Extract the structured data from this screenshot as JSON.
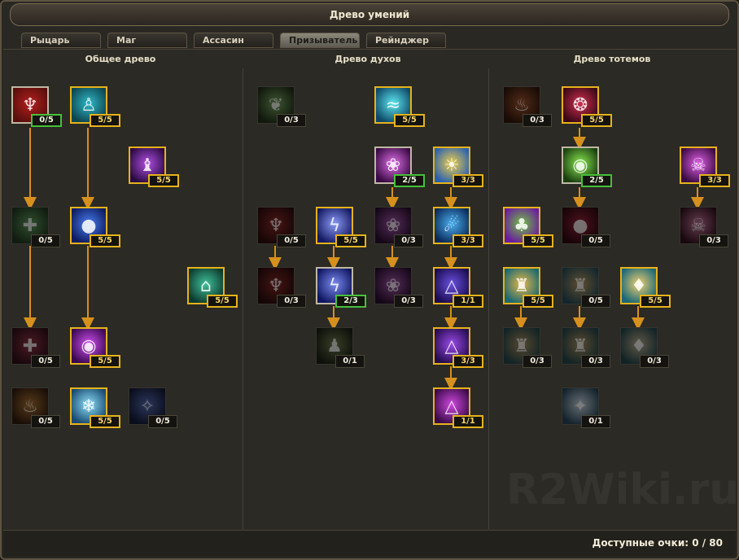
{
  "window": {
    "title": "Древо умений"
  },
  "tabs": [
    {
      "label": "Рыцарь",
      "active": false
    },
    {
      "label": "Маг",
      "active": false
    },
    {
      "label": "Ассасин",
      "active": false
    },
    {
      "label": "Призыватель",
      "active": true
    },
    {
      "label": "Рейнджер",
      "active": false
    }
  ],
  "trees": [
    {
      "title": "Общее древо"
    },
    {
      "title": "Древо духов"
    },
    {
      "title": "Древо тотемов"
    }
  ],
  "skills": [
    {
      "id": "g1",
      "count": "0/5",
      "state": "partial",
      "icon": "demon-icon",
      "colors": [
        "#b4201e",
        "#5a0e0c"
      ]
    },
    {
      "id": "g2",
      "count": "5/5",
      "state": "maxed",
      "icon": "spirit-figure-icon",
      "colors": [
        "#2fb8c8",
        "#0d4650"
      ]
    },
    {
      "id": "g3",
      "count": "5/5",
      "state": "maxed",
      "icon": "purple-mage-icon",
      "colors": [
        "#b04ee0",
        "#2a0a44"
      ]
    },
    {
      "id": "g4",
      "count": "0/5",
      "state": "locked",
      "icon": "holy-cross-icon",
      "colors": [
        "#4ea24a",
        "#1a3a18"
      ]
    },
    {
      "id": "g5",
      "count": "5/5",
      "state": "maxed",
      "icon": "blue-orbs-icon",
      "colors": [
        "#4a7cf0",
        "#0c1c60"
      ]
    },
    {
      "id": "g6",
      "count": "5/5",
      "state": "maxed",
      "icon": "teal-shrine-icon",
      "colors": [
        "#40c098",
        "#0c3a2e"
      ]
    },
    {
      "id": "g7",
      "count": "0/5",
      "state": "locked",
      "icon": "red-cross-icon",
      "colors": [
        "#b02a48",
        "#3a0c18"
      ]
    },
    {
      "id": "g8",
      "count": "5/5",
      "state": "maxed",
      "icon": "purple-orb-icon",
      "colors": [
        "#d050f0",
        "#3a0850"
      ]
    },
    {
      "id": "g9",
      "count": "0/5",
      "state": "locked",
      "icon": "fire-sigil-icon",
      "colors": [
        "#c07018",
        "#3a1a04"
      ]
    },
    {
      "id": "g10",
      "count": "5/5",
      "state": "maxed",
      "icon": "ice-tree-icon",
      "colors": [
        "#8ae0f8",
        "#1a4a70"
      ]
    },
    {
      "id": "g11",
      "count": "0/5",
      "state": "locked",
      "icon": "blue-spirit-icon",
      "colors": [
        "#4a6ad0",
        "#101a44"
      ]
    },
    {
      "id": "s1",
      "count": "0/3",
      "state": "locked",
      "icon": "green-wisp-icon",
      "colors": [
        "#6ab048",
        "#1c3010"
      ]
    },
    {
      "id": "s2",
      "count": "5/5",
      "state": "maxed",
      "icon": "cyan-wave-icon",
      "colors": [
        "#5ee8f0",
        "#0e4868"
      ]
    },
    {
      "id": "s3",
      "count": "2/5",
      "state": "partial",
      "icon": "pink-lotus-icon",
      "colors": [
        "#e070e8",
        "#3a0a44"
      ]
    },
    {
      "id": "s4",
      "count": "3/3",
      "state": "maxed",
      "icon": "sun-cloud-icon",
      "colors": [
        "#f0d048",
        "#2a60b0"
      ]
    },
    {
      "id": "s5",
      "count": "0/5",
      "state": "locked",
      "icon": "red-demon-icon",
      "colors": [
        "#b02020",
        "#3a0808"
      ]
    },
    {
      "id": "s6",
      "count": "5/5",
      "state": "maxed",
      "icon": "lightning-tree-icon",
      "colors": [
        "#8a9af8",
        "#141a60"
      ]
    },
    {
      "id": "s7",
      "count": "0/3",
      "state": "locked",
      "icon": "pink-lotus-icon",
      "colors": [
        "#c050c8",
        "#300a38"
      ]
    },
    {
      "id": "s8",
      "count": "3/3",
      "state": "maxed",
      "icon": "blue-wraith-icon",
      "colors": [
        "#4ab0f0",
        "#0a2a5a"
      ]
    },
    {
      "id": "s9",
      "count": "0/3",
      "state": "locked",
      "icon": "red-demon-icon",
      "colors": [
        "#a82020",
        "#340808"
      ]
    },
    {
      "id": "s10",
      "count": "2/3",
      "state": "partial",
      "icon": "lightning-tree-icon",
      "colors": [
        "#7a8af0",
        "#101660"
      ]
    },
    {
      "id": "s11",
      "count": "0/3",
      "state": "locked",
      "icon": "pink-lotus-icon",
      "colors": [
        "#c050c8",
        "#300a38"
      ]
    },
    {
      "id": "s12",
      "count": "1/1",
      "state": "maxed",
      "icon": "triangle-rune-icon",
      "colors": [
        "#6a50e0",
        "#1a0c50"
      ]
    },
    {
      "id": "s13",
      "count": "0/1",
      "state": "locked",
      "icon": "hooded-figure-icon",
      "colors": [
        "#6a8040",
        "#1a2010"
      ]
    },
    {
      "id": "s14",
      "count": "3/3",
      "state": "maxed",
      "icon": "triangle-rune-icon",
      "colors": [
        "#9a4ae8",
        "#260c50"
      ]
    },
    {
      "id": "s15",
      "count": "1/1",
      "state": "maxed",
      "icon": "triangle-rune-icon",
      "colors": [
        "#d048e0",
        "#3a0a48"
      ]
    },
    {
      "id": "t1",
      "count": "0/3",
      "state": "locked",
      "icon": "fire-totem-icon",
      "colors": [
        "#c05018",
        "#3a1404"
      ]
    },
    {
      "id": "t2",
      "count": "5/5",
      "state": "maxed",
      "icon": "crimson-spirit-icon",
      "colors": [
        "#d03050",
        "#3a0816"
      ]
    },
    {
      "id": "t3",
      "count": "2/5",
      "state": "partial",
      "icon": "green-orb-icon",
      "colors": [
        "#8ae850",
        "#1a4010"
      ]
    },
    {
      "id": "t4",
      "count": "3/3",
      "state": "maxed",
      "icon": "skull-sigil-icon",
      "colors": [
        "#e060e8",
        "#3a0a40"
      ]
    },
    {
      "id": "t5",
      "count": "5/5",
      "state": "maxed",
      "icon": "nature-totem-icon",
      "colors": [
        "#70c040",
        "#6a1aa0"
      ]
    },
    {
      "id": "t6",
      "count": "0/5",
      "state": "locked",
      "icon": "blood-drop-icon",
      "colors": [
        "#c01838",
        "#3a0410"
      ]
    },
    {
      "id": "t7",
      "count": "0/3",
      "state": "locked",
      "icon": "pink-skull-icon",
      "colors": [
        "#e070a0",
        "#3a0c20"
      ]
    },
    {
      "id": "t8",
      "count": "5/5",
      "state": "maxed",
      "icon": "bronze-totem-icon",
      "colors": [
        "#e8b848",
        "#1a6870"
      ]
    },
    {
      "id": "t9",
      "count": "0/5",
      "state": "locked",
      "icon": "bronze-totem-icon",
      "colors": [
        "#c89848",
        "#1a5060"
      ]
    },
    {
      "id": "t10",
      "count": "5/5",
      "state": "maxed",
      "icon": "golden-flame-icon",
      "colors": [
        "#f0d070",
        "#1a6878"
      ]
    },
    {
      "id": "t11",
      "count": "0/3",
      "state": "locked",
      "icon": "bronze-totem-icon",
      "colors": [
        "#b89048",
        "#184850"
      ]
    },
    {
      "id": "t12",
      "count": "0/3",
      "state": "locked",
      "icon": "bronze-totem-icon",
      "colors": [
        "#b89048",
        "#184850"
      ]
    },
    {
      "id": "t13",
      "count": "0/3",
      "state": "locked",
      "icon": "golden-flame-icon",
      "colors": [
        "#c0b080",
        "#184850"
      ]
    },
    {
      "id": "t14",
      "count": "0/1",
      "state": "locked",
      "icon": "white-totem-icon",
      "colors": [
        "#c8d8e8",
        "#1a4860"
      ]
    }
  ],
  "footer": {
    "points_label": "Доступные очки: 0 / 80"
  },
  "watermark": "R2Wiki.ru",
  "colors": {
    "gold": "#e6b21c",
    "green": "#46c03a",
    "arrow": "#d6901e"
  }
}
